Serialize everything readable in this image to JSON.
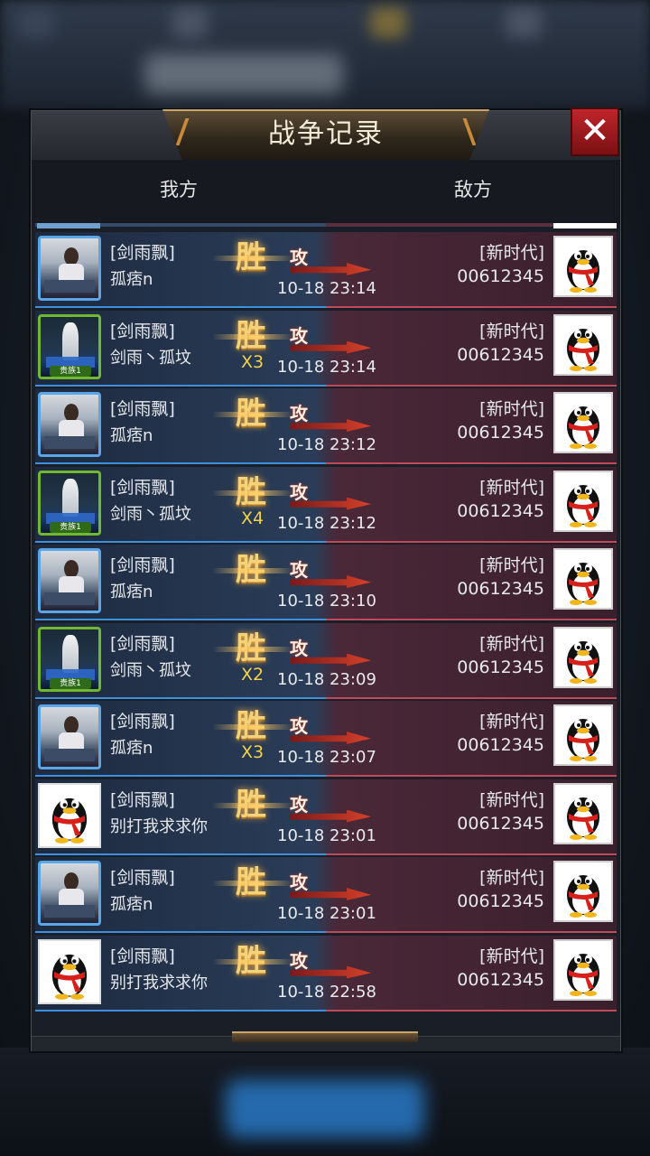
{
  "dialog": {
    "title": "战争记录",
    "close_label": "✕",
    "col_ours": "我方",
    "col_enemy": "敌方"
  },
  "colors": {
    "ally_side": "#2a3d58",
    "enemy_side": "#4a2838",
    "win_text": "#f3d27a",
    "multiplier": "#f3d24a",
    "close_red": "#c0252a"
  },
  "records": [
    {
      "ally_guild": "[剑雨飘]",
      "ally_name": "孤痞n",
      "avatar": "photo",
      "result": "胜",
      "action": "攻",
      "multiplier": "",
      "time": "10-18 23:14",
      "enemy_guild": "[新时代]",
      "enemy_id": "00612345"
    },
    {
      "ally_guild": "[剑雨飘]",
      "ally_name": "剑雨丶孤坟",
      "avatar": "green",
      "avatar_tag": "贵族1",
      "result": "胜",
      "action": "攻",
      "multiplier": "X3",
      "time": "10-18 23:14",
      "enemy_guild": "[新时代]",
      "enemy_id": "00612345"
    },
    {
      "ally_guild": "[剑雨飘]",
      "ally_name": "孤痞n",
      "avatar": "photo",
      "result": "胜",
      "action": "攻",
      "multiplier": "",
      "time": "10-18 23:12",
      "enemy_guild": "[新时代]",
      "enemy_id": "00612345"
    },
    {
      "ally_guild": "[剑雨飘]",
      "ally_name": "剑雨丶孤坟",
      "avatar": "green",
      "avatar_tag": "贵族1",
      "result": "胜",
      "action": "攻",
      "multiplier": "X4",
      "time": "10-18 23:12",
      "enemy_guild": "[新时代]",
      "enemy_id": "00612345"
    },
    {
      "ally_guild": "[剑雨飘]",
      "ally_name": "孤痞n",
      "avatar": "photo",
      "result": "胜",
      "action": "攻",
      "multiplier": "",
      "time": "10-18 23:10",
      "enemy_guild": "[新时代]",
      "enemy_id": "00612345"
    },
    {
      "ally_guild": "[剑雨飘]",
      "ally_name": "剑雨丶孤坟",
      "avatar": "green",
      "avatar_tag": "贵族1",
      "result": "胜",
      "action": "攻",
      "multiplier": "X2",
      "time": "10-18 23:09",
      "enemy_guild": "[新时代]",
      "enemy_id": "00612345"
    },
    {
      "ally_guild": "[剑雨飘]",
      "ally_name": "孤痞n",
      "avatar": "photo",
      "result": "胜",
      "action": "攻",
      "multiplier": "X3",
      "time": "10-18 23:07",
      "enemy_guild": "[新时代]",
      "enemy_id": "00612345"
    },
    {
      "ally_guild": "[剑雨飘]",
      "ally_name": "别打我求求你",
      "avatar": "penguin",
      "result": "胜",
      "action": "攻",
      "multiplier": "",
      "time": "10-18 23:01",
      "enemy_guild": "[新时代]",
      "enemy_id": "00612345"
    },
    {
      "ally_guild": "[剑雨飘]",
      "ally_name": "孤痞n",
      "avatar": "photo",
      "result": "胜",
      "action": "攻",
      "multiplier": "",
      "time": "10-18 23:01",
      "enemy_guild": "[新时代]",
      "enemy_id": "00612345"
    },
    {
      "ally_guild": "[剑雨飘]",
      "ally_name": "别打我求求你",
      "avatar": "penguin",
      "result": "胜",
      "action": "攻",
      "multiplier": "",
      "time": "10-18 22:58",
      "enemy_guild": "[新时代]",
      "enemy_id": "00612345"
    }
  ]
}
